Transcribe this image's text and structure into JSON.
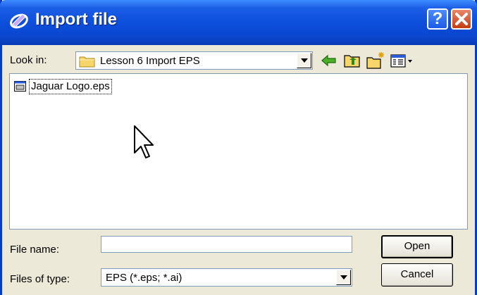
{
  "window": {
    "title": "Import file",
    "help_glyph": "?",
    "close_glyph": "X"
  },
  "lookin": {
    "label": "Look in:",
    "value": "Lesson 6 Import EPS"
  },
  "toolbar": {
    "icons": [
      "back-arrow-icon",
      "up-folder-icon",
      "new-folder-icon",
      "view-menu-icon"
    ]
  },
  "files": [
    {
      "name": "Jaguar Logo.eps",
      "icon": "eps-file-icon"
    }
  ],
  "filename": {
    "label": "File name:",
    "value": ""
  },
  "filetype": {
    "label": "Files of type:",
    "value": "EPS (*.eps; *.ai)"
  },
  "buttons": {
    "open": "Open",
    "cancel": "Cancel"
  },
  "colors": {
    "titlebar": "#0c4fdc",
    "dialog": "#ece9d8",
    "close": "#c33d12"
  }
}
